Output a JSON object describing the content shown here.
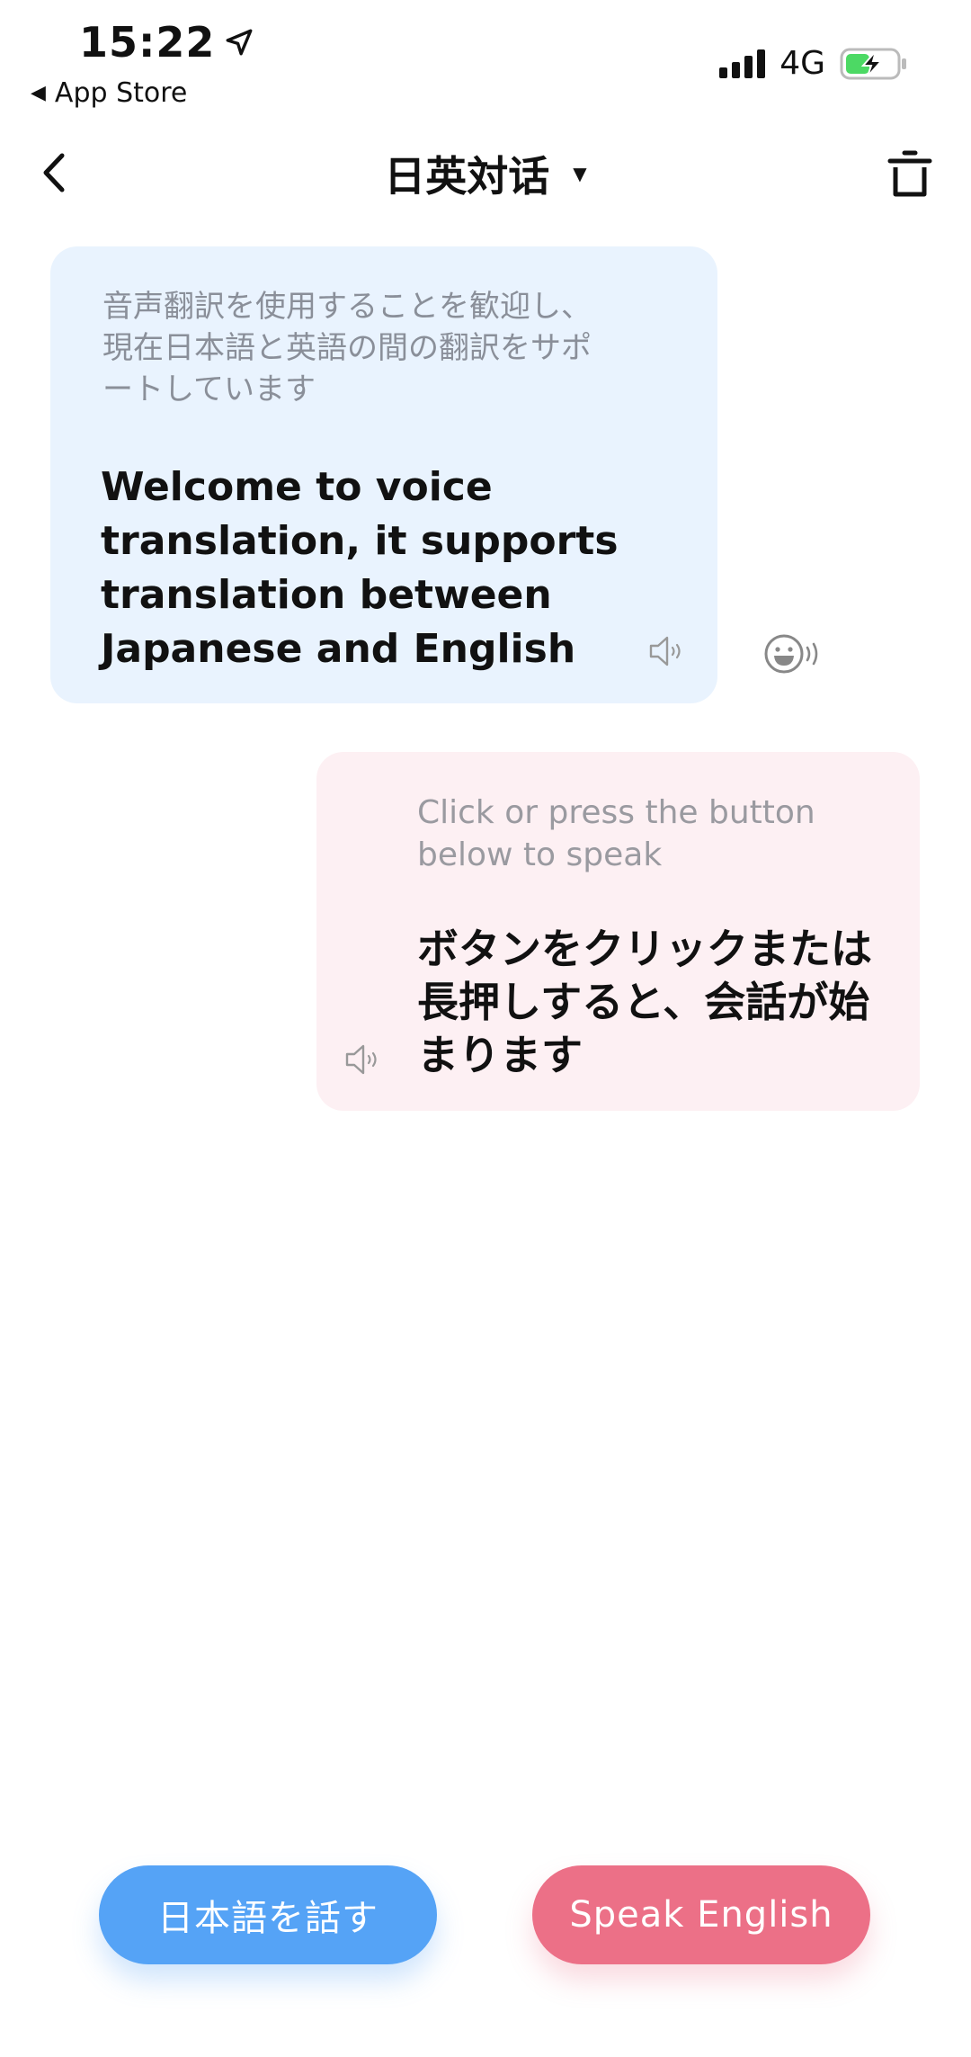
{
  "status_bar": {
    "time": "15:22",
    "back_app": "App Store",
    "network": "4G"
  },
  "nav": {
    "title": "日英対话"
  },
  "messages": [
    {
      "side": "left",
      "subtitle": "音声翻訳を使用することを歓迎し、現在日本語と英語の間の翻訳をサポートしています",
      "main": "Welcome to voice translation, it supports translation between Japanese and English"
    },
    {
      "side": "right",
      "subtitle": "Click or press the button below to speak",
      "main": "ボタンをクリックまたは長押しすると、会話が始まります"
    }
  ],
  "buttons": {
    "speak_japanese": "日本語を話す",
    "speak_english": "Speak English"
  },
  "colors": {
    "left_bubble": "#e9f3fe",
    "right_bubble": "#fdf0f3",
    "blue_button": "#55a3f6",
    "pink_button": "#ec7087",
    "battery_green": "#4cd964"
  },
  "icons": [
    "location-arrow-icon",
    "signal-icon",
    "battery-charging-icon",
    "back-chevron-icon",
    "dropdown-caret-icon",
    "trash-icon",
    "speaker-icon",
    "voice-emoji-icon"
  ]
}
